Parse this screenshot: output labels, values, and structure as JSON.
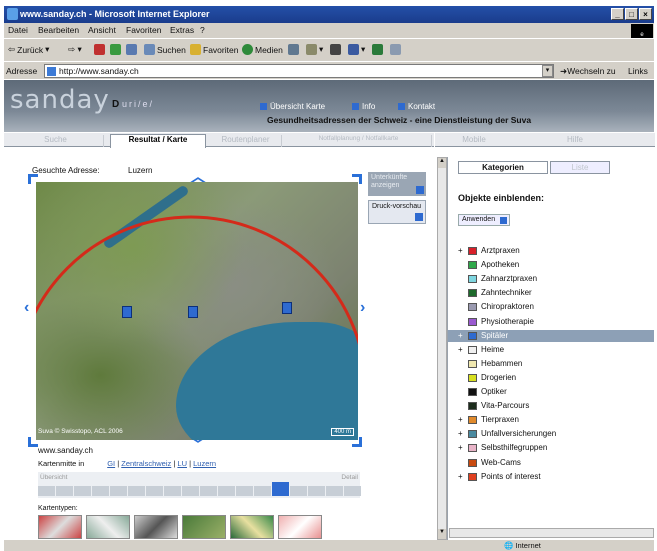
{
  "window": {
    "title": "www.sanday.ch - Microsoft Internet Explorer",
    "controls": [
      "_",
      "□",
      "×"
    ]
  },
  "menu": [
    "Datei",
    "Bearbeiten",
    "Ansicht",
    "Favoriten",
    "Extras",
    "?"
  ],
  "toolbar": {
    "back": "Zurück",
    "search": "Suchen",
    "favorites": "Favoriten",
    "media": "Medien"
  },
  "address": {
    "label": "Adresse",
    "url": "http://www.sanday.ch",
    "go": "Wechseln zu",
    "links": "Links »"
  },
  "site": {
    "logo": "sanday",
    "logo_d": "D",
    "tagline": "uri/e/",
    "toplinks": [
      "Übersicht Karte",
      "Info",
      "Kontakt"
    ],
    "title": "Gesundheitsadressen der Schweiz - eine Dienstleistung der Suva"
  },
  "tabs": [
    "Suche",
    "Resultat / Karte",
    "Routenplaner",
    "Notfallplanung / Notfallkarte",
    "Mobile",
    "Hilfe"
  ],
  "search": {
    "label": "Gesuchte Adresse:",
    "value": "Luzern"
  },
  "map": {
    "copyright": "Suva © Swisstopo, ACL 2006",
    "scale": "400 m",
    "side_buttons": [
      "Unterkünfte anzeigen",
      "Druck-vorschau"
    ],
    "url": "www.sanday.ch",
    "center_label": "Kartenmitte in",
    "center_links": [
      "GI",
      "Zentralschweiz",
      "LU",
      "Luzern"
    ],
    "zoom_left": "Übersicht",
    "zoom_right": "Detail",
    "zoom_level": 14,
    "zoom_steps": 18,
    "types_label": "Kartentypen:"
  },
  "panel": {
    "tabs": [
      "Kategorien",
      "Liste"
    ],
    "heading": "Objekte einblenden:",
    "apply": "Anwenden",
    "categories": [
      {
        "plus": "+",
        "label": "Arztpraxen",
        "color": "#d8202a"
      },
      {
        "plus": "",
        "label": "Apotheken",
        "color": "#2fa84a"
      },
      {
        "plus": "",
        "label": "Zahnarztpraxen",
        "color": "#7fd6e0"
      },
      {
        "plus": "",
        "label": "Zahntechniker",
        "color": "#1e6a2c"
      },
      {
        "plus": "",
        "label": "Chiropraktoren",
        "color": "#9a9ab0"
      },
      {
        "plus": "",
        "label": "Physiotherapie",
        "color": "#9a5ad0"
      },
      {
        "plus": "+",
        "label": "Spitäler",
        "color": "#2e6ad0",
        "highlight": true
      },
      {
        "plus": "+",
        "label": "Heime",
        "color": "#f0f0f0"
      },
      {
        "plus": "",
        "label": "Hebammen",
        "color": "#f0e8b0"
      },
      {
        "plus": "",
        "label": "Drogerien",
        "color": "#d8e020"
      },
      {
        "plus": "",
        "label": "Optiker",
        "color": "#111111"
      },
      {
        "plus": "",
        "label": "Vita-Parcours",
        "color": "#1c2c1c"
      },
      {
        "plus": "+",
        "label": "Tierpraxen",
        "color": "#e08a2c"
      },
      {
        "plus": "+",
        "label": "Unfallversicherungen",
        "color": "#4a8aa0"
      },
      {
        "plus": "+",
        "label": "Selbsthilfegruppen",
        "color": "#e8b4c8"
      },
      {
        "plus": "",
        "label": "Web-Cams",
        "color": "#c84a10"
      },
      {
        "plus": "+",
        "label": "Points of interest",
        "color": "#e04020"
      }
    ]
  },
  "status": {
    "zone": "Internet"
  },
  "colors": {
    "accent": "#2e6ad0",
    "circle": "#d42a1a",
    "header": "#6e7a88"
  }
}
